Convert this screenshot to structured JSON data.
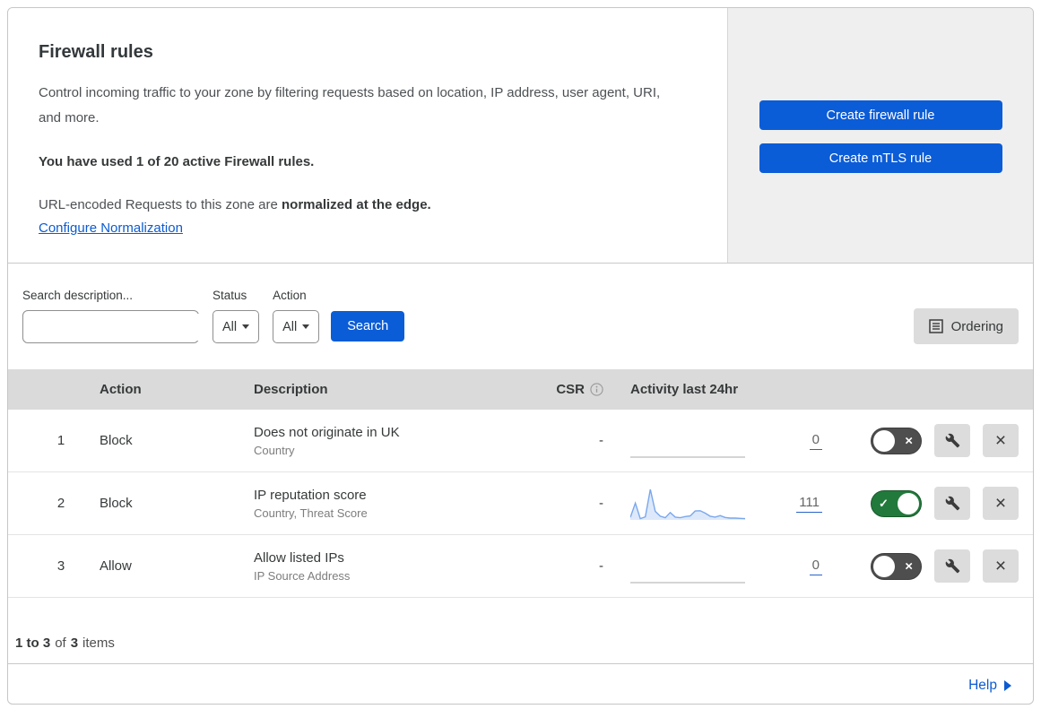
{
  "header": {
    "title": "Firewall rules",
    "description": "Control incoming traffic to your zone by filtering requests based on location, IP address, user agent, URI, and more.",
    "usage": "You have used 1 of 20 active Firewall rules.",
    "normalization_prefix": "URL-encoded Requests to this zone are",
    "normalization_bold": "normalized at the edge.",
    "normalization_link": "Configure Normalization"
  },
  "actions": {
    "create_firewall_rule": "Create firewall rule",
    "create_mtls_rule": "Create mTLS rule"
  },
  "filters": {
    "search_label": "Search description...",
    "status_label": "Status",
    "status_value": "All",
    "action_label": "Action",
    "action_value": "All",
    "search_button": "Search",
    "ordering_button": "Ordering"
  },
  "table": {
    "headers": {
      "action": "Action",
      "description": "Description",
      "csr": "CSR",
      "activity": "Activity last 24hr"
    },
    "rows": [
      {
        "priority": "1",
        "action": "Block",
        "description": "Does not originate in UK",
        "criteria": "Country",
        "csr": "-",
        "activity_count": "0",
        "enabled": false,
        "sparkline": null
      },
      {
        "priority": "2",
        "action": "Block",
        "description": "IP reputation score",
        "criteria": "Country, Threat Score",
        "csr": "-",
        "activity_count": "111",
        "enabled": true,
        "sparkline": [
          8,
          55,
          4,
          10,
          100,
          28,
          12,
          7,
          24,
          9,
          7,
          11,
          13,
          29,
          30,
          22,
          12,
          9,
          14,
          8,
          6,
          6,
          5,
          4
        ]
      },
      {
        "priority": "3",
        "action": "Allow",
        "description": "Allow listed IPs",
        "criteria": "IP Source Address",
        "csr": "-",
        "activity_count": "0",
        "enabled": false,
        "sparkline": null
      }
    ]
  },
  "footer": {
    "range": "1 to 3",
    "of": "of",
    "total": "3",
    "items": "items"
  },
  "help": {
    "label": "Help"
  },
  "icons": {
    "check": "✓",
    "close": "×"
  },
  "colors": {
    "accent_blue": "#0b5cd7",
    "link_blue": "#0c5bd1",
    "toggle_on": "#217a3c",
    "toggle_off": "#4e4e4e",
    "sparkline_line": "#7aa7ec",
    "sparkline_fill": "#dde9fb",
    "flat_line": "#c7c7c7"
  }
}
